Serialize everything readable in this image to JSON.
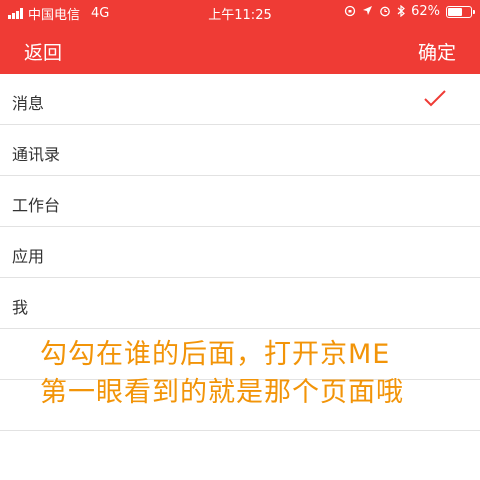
{
  "status_bar": {
    "carrier": "中国电信",
    "network": "4G",
    "time": "上午11:25",
    "battery_percent": "62%",
    "battery_level": 0.62
  },
  "nav": {
    "back_label": "返回",
    "confirm_label": "确定"
  },
  "list": {
    "items": [
      {
        "label": "消息",
        "checked": true
      },
      {
        "label": "通讯录",
        "checked": false
      },
      {
        "label": "工作台",
        "checked": false
      },
      {
        "label": "应用",
        "checked": false
      },
      {
        "label": "我",
        "checked": false
      },
      {
        "label": "",
        "checked": false
      },
      {
        "label": "",
        "checked": false
      }
    ]
  },
  "overlay": {
    "line1": "勾勾在谁的后面，打开京ME",
    "line2": "第一眼看到的就是那个页面哦"
  },
  "colors": {
    "brand_red": "#ef3b35",
    "check": "#ef3b35",
    "overlay_text": "#f29408"
  },
  "icons": {
    "signal": "signal-icon",
    "location": "location-icon",
    "alarm": "alarm-icon",
    "bluetooth": "bluetooth-icon",
    "lock": "rotation-lock-icon",
    "check": "check-icon"
  }
}
